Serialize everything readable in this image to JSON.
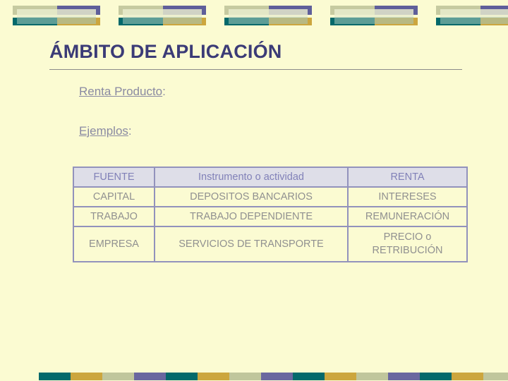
{
  "slide": {
    "title": "ÁMBITO DE APLICACIÓN",
    "background_color": "#fbfbd2",
    "title_color": "#3b3b77"
  },
  "subtitles": [
    {
      "underlined": "Renta Producto",
      "suffix": ":"
    },
    {
      "underlined": "Ejemplos",
      "suffix": ":"
    }
  ],
  "decor": {
    "palette": {
      "teal": "#04696b",
      "gold": "#cca63e",
      "sage": "#c0c69c",
      "purple": "#6a679f",
      "pale_sage": "#c6caa0"
    },
    "top_block_count": 5,
    "bottom_block_count": 5
  },
  "table": {
    "headers": [
      "FUENTE",
      "Instrumento o actividad",
      "RENTA"
    ],
    "rows": [
      {
        "fuente": "CAPITAL",
        "instrumento": "DEPOSITOS BANCARIOS",
        "renta": "INTERESES",
        "tall": false
      },
      {
        "fuente": "TRABAJO",
        "instrumento": "TRABAJO DEPENDIENTE",
        "renta": "REMUNERACIÓN",
        "tall": false
      },
      {
        "fuente": "EMPRESA",
        "instrumento": "SERVICIOS DE TRANSPORTE",
        "renta": "PRECIO o RETRIBUCIÓN",
        "tall": true
      }
    ],
    "header_bg": "#dedee8",
    "header_text_color": "#8181b8",
    "body_text_color": "#909090",
    "border_color": "#9292bc"
  }
}
